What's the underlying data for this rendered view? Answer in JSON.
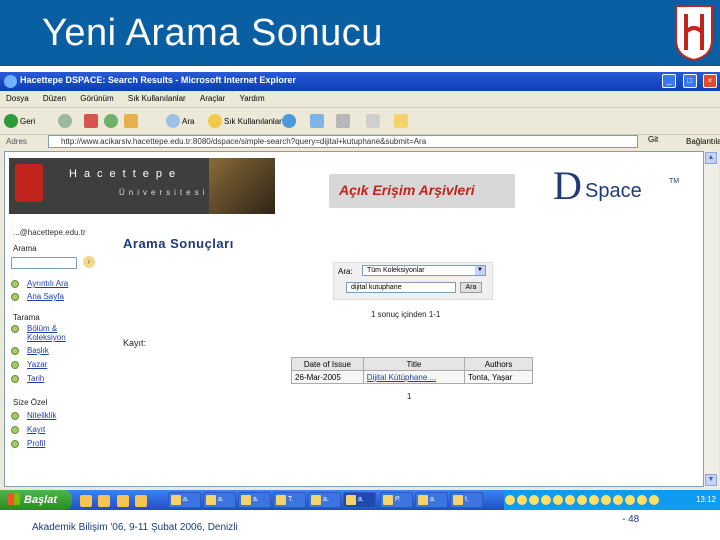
{
  "slide": {
    "title": "Yeni Arama Sonucu",
    "footer_left": "Akademik Bilişim '06, 9-11 Şubat 2006, Denizli",
    "footer_right": "- 48"
  },
  "browser": {
    "window_title": "Hacettepe DSPACE: Search Results - Microsoft Internet Explorer",
    "menu": [
      "Dosya",
      "Düzen",
      "Görünüm",
      "Sık Kullanılanlar",
      "Araçlar",
      "Yardım"
    ],
    "toolbar": {
      "back": "Geri",
      "search": "Ara",
      "favorites": "Sık Kullanılanlar"
    },
    "address_label": "Adres",
    "address_url": "http://www.acikarsiv.hacettepe.edu.tr:8080/dspace/simple-search?query=dijital+kutuphane&submit=Ara",
    "go_label": "Git",
    "links_label": "Bağlantılar"
  },
  "page": {
    "hu_name": "Hacettepe",
    "hu_sub": "Üniversitesi",
    "aa_logo": "Açık Erişim Arşivleri",
    "dspace_logo": {
      "d": "D",
      "rest": "Space",
      "tm": "TM"
    },
    "user_email": "...@hacettepe.edu.tr",
    "sidebar": {
      "search_label": "Arama",
      "search_links": [
        "Ayrıntılı Ara",
        "Ana Sayfa"
      ],
      "browse_label": "Tarama",
      "browse_links": [
        "Bölüm & Koleksiyon",
        "Başlık",
        "Yazar",
        "Tarih"
      ],
      "personal_label": "Size Özel",
      "personal_links": [
        "Niteliklik",
        "Kayıt",
        "Profil"
      ]
    },
    "main": {
      "title": "Arama Sonuçları",
      "search_in_label": "Ara:",
      "search_scope": "Tüm Koleksiyonlar",
      "query": "dijital kutuphane",
      "search_button": "Ara",
      "results_summary": "1 sonuç içinden 1-1",
      "records_label": "Kayıt:",
      "table": {
        "headers": [
          "Date of Issue",
          "Title",
          "Authors"
        ],
        "rows": [
          [
            "26-Mar-2005",
            "Dijital Kütüphane ...",
            "Tonta, Yaşar"
          ]
        ]
      },
      "page_number": "1"
    }
  },
  "taskbar": {
    "start_label": "Başlat",
    "tasks": [
      "a.",
      "a.",
      "a.",
      "T.",
      "a.",
      "a.",
      "P.",
      "a.",
      "t."
    ],
    "clock": "13:12"
  },
  "colors": {
    "header_blue": "#0a5fa3",
    "link_blue": "#1f3ea8",
    "brand_red": "#c0241d"
  }
}
